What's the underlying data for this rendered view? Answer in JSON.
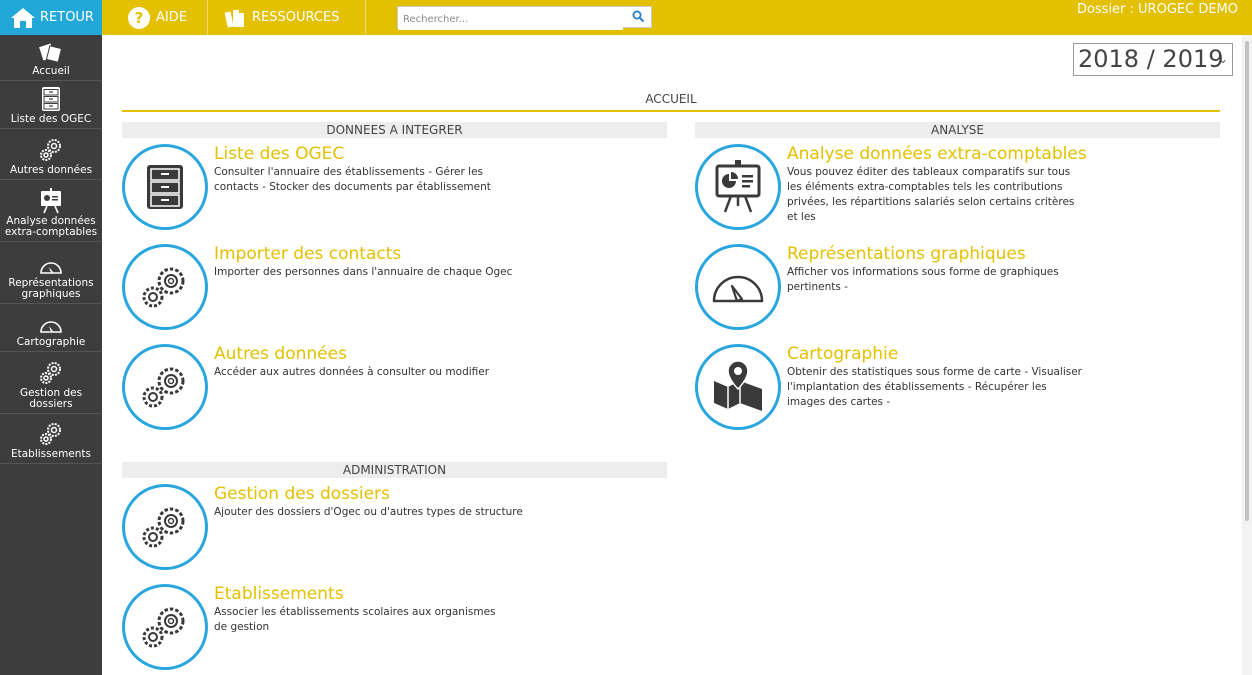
{
  "topbar": {
    "retour_label": "RETOUR",
    "aide_label": "AIDE",
    "ressources_label": "RESSOURCES",
    "search_placeholder": "Rechercher...",
    "dossier_label": "Dossier : UROGEC DEMO",
    "color_bar": "#e3c000",
    "color_retour": "#21a8d8"
  },
  "sidebar": {
    "items": [
      {
        "label": "Accueil",
        "icon": "cards-icon"
      },
      {
        "label": "Liste des OGEC",
        "icon": "cabinet-icon"
      },
      {
        "label": "Autres données",
        "icon": "gears-icon"
      },
      {
        "label": "Analyse données extra-comptables",
        "icon": "presentation-icon"
      },
      {
        "label": "Représentations graphiques",
        "icon": "gauge-icon"
      },
      {
        "label": "Cartographie",
        "icon": "gauge-icon"
      },
      {
        "label": "Gestion des dossiers",
        "icon": "gears-icon"
      },
      {
        "label": "Etablissements",
        "icon": "gears-icon"
      }
    ]
  },
  "year_select": {
    "value": "2018 / 2019"
  },
  "main": {
    "title": "ACCUEIL",
    "sections": [
      {
        "title": "DONNEES A INTEGRER",
        "cards": [
          {
            "title": "Liste des OGEC",
            "desc": "Consulter l'annuaire des établissements - Gérer les contacts - Stocker des documents par établissement",
            "icon": "cabinet-icon"
          },
          {
            "title": "Importer des contacts",
            "desc": "Importer des personnes dans l'annuaire de chaque Ogec",
            "icon": "gears-icon"
          },
          {
            "title": "Autres données",
            "desc": "Accéder aux autres données à consulter ou modifier",
            "icon": "gears-icon"
          }
        ]
      },
      {
        "title": "ANALYSE",
        "cards": [
          {
            "title": "Analyse données extra-comptables",
            "desc": "Vous pouvez éditer des tableaux comparatifs sur tous les éléments extra-comptables tels les contributions privées, les répartitions salariés selon certains critères et les",
            "icon": "presentation-icon"
          },
          {
            "title": "Représentations graphiques",
            "desc": "Afficher vos informations sous forme de graphiques pertinents -",
            "icon": "gauge-icon"
          },
          {
            "title": "Cartographie",
            "desc": "Obtenir des statistiques sous forme de carte - Visualiser l'implantation des établissements - Récupérer les images des cartes -",
            "icon": "map-pin-icon"
          }
        ]
      },
      {
        "title": "ADMINISTRATION",
        "cards": [
          {
            "title": "Gestion des dossiers",
            "desc": "Ajouter des dossiers d'Ogec ou d'autres types de structure",
            "icon": "gears-icon"
          },
          {
            "title": "Etablissements",
            "desc": "Associer les établissements scolaires aux organismes de gestion",
            "icon": "gears-icon"
          }
        ]
      }
    ]
  }
}
